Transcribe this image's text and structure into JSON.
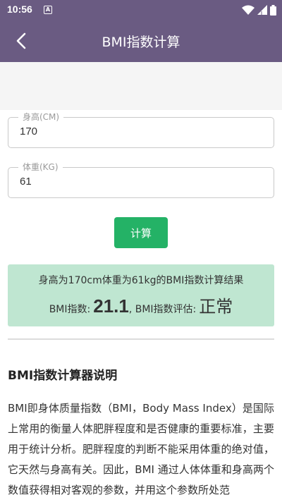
{
  "status_bar": {
    "time": "10:56",
    "notification_glyph": "A"
  },
  "app_bar": {
    "title": "BMI指数计算"
  },
  "form": {
    "height_label": "身高(CM)",
    "height_value": "170",
    "weight_label": "体重(KG)",
    "weight_value": "61",
    "calculate_label": "计算"
  },
  "result": {
    "summary": "身高为170cm体重为61kg的BMI指数计算结果",
    "bmi_label": "BMI指数:",
    "bmi_value": "21.1",
    "eval_label": ", BMI指数评估:",
    "eval_value": "正常"
  },
  "info": {
    "title": "BMI指数计算器说明",
    "body": "BMI即身体质量指数（BMI，Body Mass Index）是国际上常用的衡量人体肥胖程度和是否健康的重要标准，主要用于统计分析。肥胖程度的判断不能采用体重的绝对值，它天然与身高有关。因此，BMI 通过人体体重和身高两个数值获得相对客观的参数，并用这个参数所处范"
  },
  "colors": {
    "primary": "#6a5b82",
    "button": "#24b266",
    "result_bg": "#bfe6d1"
  }
}
